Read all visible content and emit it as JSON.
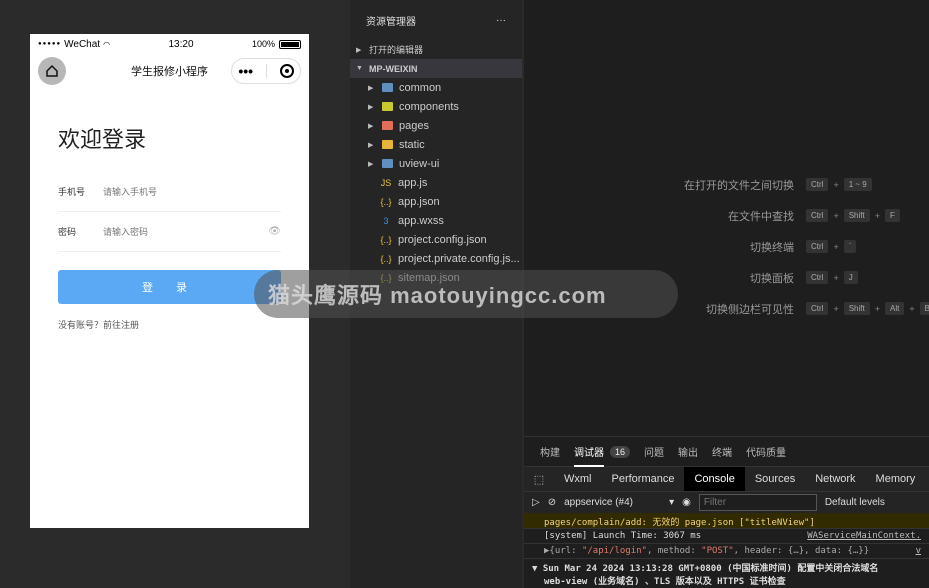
{
  "simulator": {
    "status": {
      "signal": "●●●●●",
      "carrier": "WeChat",
      "time": "13:20",
      "battery": "100%"
    },
    "nav": {
      "title": "学生报修小程序",
      "capsule_more": "•••"
    },
    "login": {
      "title": "欢迎登录",
      "phone_label": "手机号",
      "phone_placeholder": "请输入手机号",
      "password_label": "密码",
      "password_placeholder": "请输入密码",
      "button": "登 录",
      "register": "没有账号？前往注册"
    }
  },
  "explorer": {
    "title": "资源管理器",
    "more": "···",
    "open_editors": "打开的编辑器",
    "root": "MP-WEIXIN",
    "items": [
      {
        "name": "common",
        "type": "folder",
        "color": "#5f8fbf"
      },
      {
        "name": "components",
        "type": "folder",
        "color": "#c9c92e"
      },
      {
        "name": "pages",
        "type": "folder",
        "color": "#e06f5a"
      },
      {
        "name": "static",
        "type": "folder",
        "color": "#e8b53b"
      },
      {
        "name": "uview-ui",
        "type": "folder",
        "color": "#5f8fbf"
      },
      {
        "name": "app.js",
        "type": "file",
        "icon": "JS",
        "color": "#e8c43b"
      },
      {
        "name": "app.json",
        "type": "file",
        "icon": "{..}",
        "color": "#e8c43b"
      },
      {
        "name": "app.wxss",
        "type": "file",
        "icon": "3",
        "color": "#3b8fe8"
      },
      {
        "name": "project.config.json",
        "type": "file",
        "icon": "{..}",
        "color": "#e8c43b"
      },
      {
        "name": "project.private.config.js...",
        "type": "file",
        "icon": "{..}",
        "color": "#e8c43b"
      },
      {
        "name": "sitemap.json",
        "type": "file",
        "icon": "{..}",
        "color": "#e8c43b"
      }
    ]
  },
  "shortcuts": [
    {
      "desc": "在打开的文件之间切换",
      "keys": [
        "Ctrl",
        "1 ~ 9"
      ]
    },
    {
      "desc": "在文件中查找",
      "keys": [
        "Ctrl",
        "Shift",
        "F"
      ]
    },
    {
      "desc": "切换终端",
      "keys": [
        "Ctrl",
        "`"
      ]
    },
    {
      "desc": "切换面板",
      "keys": [
        "Ctrl",
        "J"
      ]
    },
    {
      "desc": "切换侧边栏可见性",
      "keys": [
        "Ctrl",
        "Shift",
        "Alt",
        "B"
      ]
    }
  ],
  "watermark": "猫头鹰源码 maotouyingcc.com",
  "bottom_panel": {
    "tabs": [
      "构建",
      "调试器",
      "问题",
      "输出",
      "终端",
      "代码质量"
    ],
    "debugger_count": "16",
    "devtools_tabs": [
      "Wxml",
      "Performance",
      "Console",
      "Sources",
      "Network",
      "Memory"
    ],
    "context": "appservice (#4)",
    "filter_placeholder": "Filter",
    "levels": "Default levels",
    "logs": {
      "warn": "pages/complain/add: 无效的 page.json [\"titleNView\"]",
      "launch": "[system] Launch Time: 3067 ms",
      "launch_source": "WAServiceMainContext.",
      "request_prefix": "▶{url: ",
      "request_url": "\"/api/login\"",
      "request_mid": ", method: ",
      "request_method": "\"POST\"",
      "request_suffix": ", header: {…}, data: {…}}",
      "request_source": "v",
      "date_line": "▼ Sun Mar 24 2024 13:13:28 GMT+0800 (中国标准时间) 配置中关闭合法域名",
      "date_line2": "web-view (业务域名) 、TLS 版本以及 HTTPS 证书检查"
    }
  }
}
